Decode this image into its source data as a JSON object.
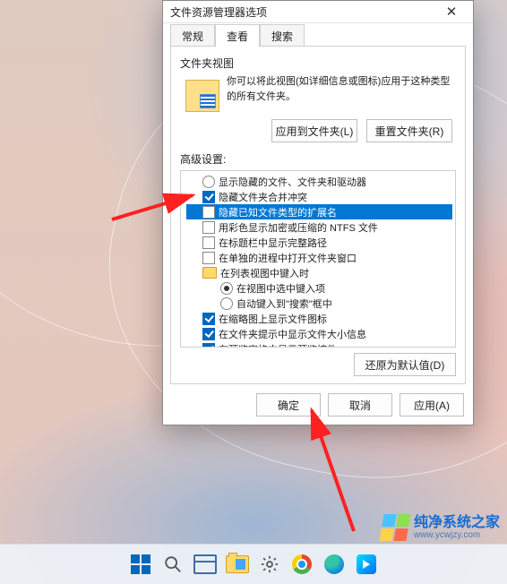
{
  "dialog": {
    "title": "文件资源管理器选项",
    "close_glyph": "✕",
    "tabs": {
      "general": "常规",
      "view": "查看",
      "search": "搜索"
    },
    "folder_views": {
      "label": "文件夹视图",
      "desc": "你可以将此视图(如详细信息或图标)应用于这种类型的所有文件夹。",
      "apply_btn": "应用到文件夹(L)",
      "reset_btn": "重置文件夹(R)"
    },
    "advanced": {
      "label": "高级设置:",
      "items": {
        "i1": "显示隐藏的文件、文件夹和驱动器",
        "i2": "隐藏文件夹合并冲突",
        "i3": "隐藏已知文件类型的扩展名",
        "i4": "用彩色显示加密或压缩的 NTFS 文件",
        "i5": "在标题栏中显示完整路径",
        "i6": "在单独的进程中打开文件夹窗口",
        "folder": "在列表视图中键入时",
        "r1": "在视图中选中键入项",
        "r2": "自动键入到\"搜索\"框中",
        "i7": "在缩略图上显示文件图标",
        "i8": "在文件夹提示中显示文件大小信息",
        "i9": "在预览窗格中显示预览控件"
      }
    },
    "restore_btn": "还原为默认值(D)",
    "footer": {
      "ok": "确定",
      "cancel": "取消",
      "apply": "应用(A)"
    }
  },
  "watermark": {
    "title": "纯净系统之家",
    "url": "www.ycwjzy.com"
  },
  "icons": {
    "close": "close-icon",
    "folder_view": "folder-view-icon",
    "start": "start-icon",
    "search": "search-icon",
    "taskview": "task-view-icon",
    "explorer": "file-explorer-icon",
    "settings": "settings-icon",
    "chrome": "chrome-icon",
    "edge": "edge-icon",
    "video": "video-app-icon"
  }
}
